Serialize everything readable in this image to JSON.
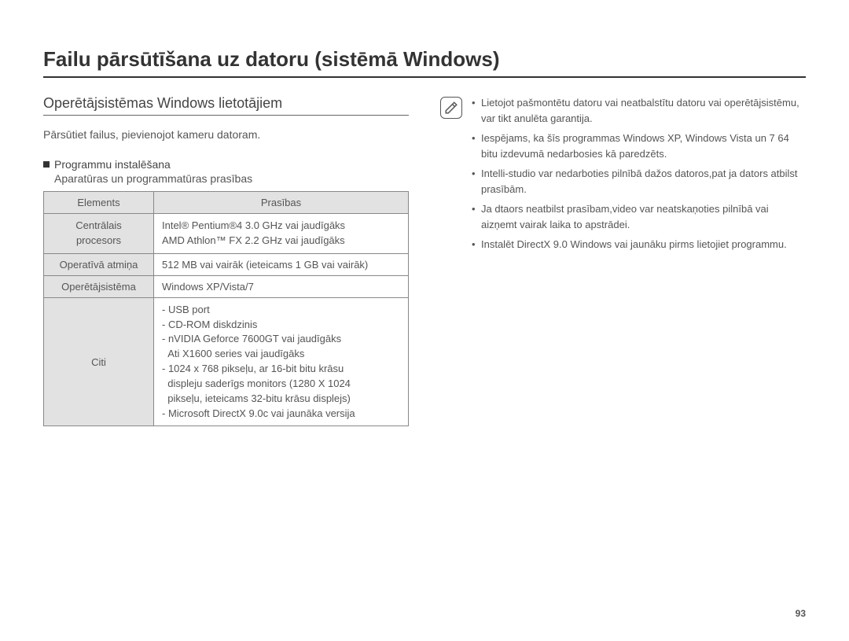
{
  "title": "Failu pārsūtīšana uz datoru (sistēmā Windows)",
  "subtitle": "Operētājsistēmas Windows lietotājiem",
  "intro": "Pārsūtiet failus, pievienojot kameru datoram.",
  "section_head": "Programmu instalēšana",
  "section_sub": "Aparatūras un programmatūras prasības",
  "table": {
    "head_left": "Elements",
    "head_right": "Prasības",
    "rows": [
      {
        "label": "Centrālais procesors",
        "value": "Intel® Pentium®4 3.0 GHz vai jaudīgāks\nAMD Athlon™ FX 2.2 GHz vai jaudīgāks"
      },
      {
        "label": "Operatīvā atmiņa",
        "value": "512 MB vai vairāk (ieteicams 1 GB vai vairāk)"
      },
      {
        "label": "Operētājsistēma",
        "value": "Windows XP/Vista/7"
      },
      {
        "label": "Citi",
        "value": "- USB port\n- CD-ROM diskdzinis\n- nVIDIA Geforce 7600GT vai jaudīgāks\n  Ati X1600 series vai jaudīgāks\n- 1024 x 768 pikseļu, ar 16-bit bitu krāsu\n  displeju saderīgs monitors (1280 X 1024\n  pikseļu, ieteicams 32-bitu krāsu displejs)\n- Microsoft DirectX 9.0c vai jaunāka versija"
      }
    ]
  },
  "notes": [
    "Lietojot pašmontētu datoru vai neatbalstītu datoru vai operētājsistēmu, var tikt anulēta garantija.",
    "Iespējams, ka šīs programmas Windows XP, Windows Vista un 7 64 bitu izdevumā nedarbosies kā paredzēts.",
    "Intelli-studio var nedarboties pilnībā dažos datoros,pat ja dators atbilst prasībām.",
    "Ja dtaors neatbilst prasībam,video var neatskaņoties pilnībā vai aizņemt vairak laika to apstrādei.",
    "Instalēt DirectX 9.0 Windows vai jaunāku pirms lietojiet programmu."
  ],
  "page_number": "93"
}
